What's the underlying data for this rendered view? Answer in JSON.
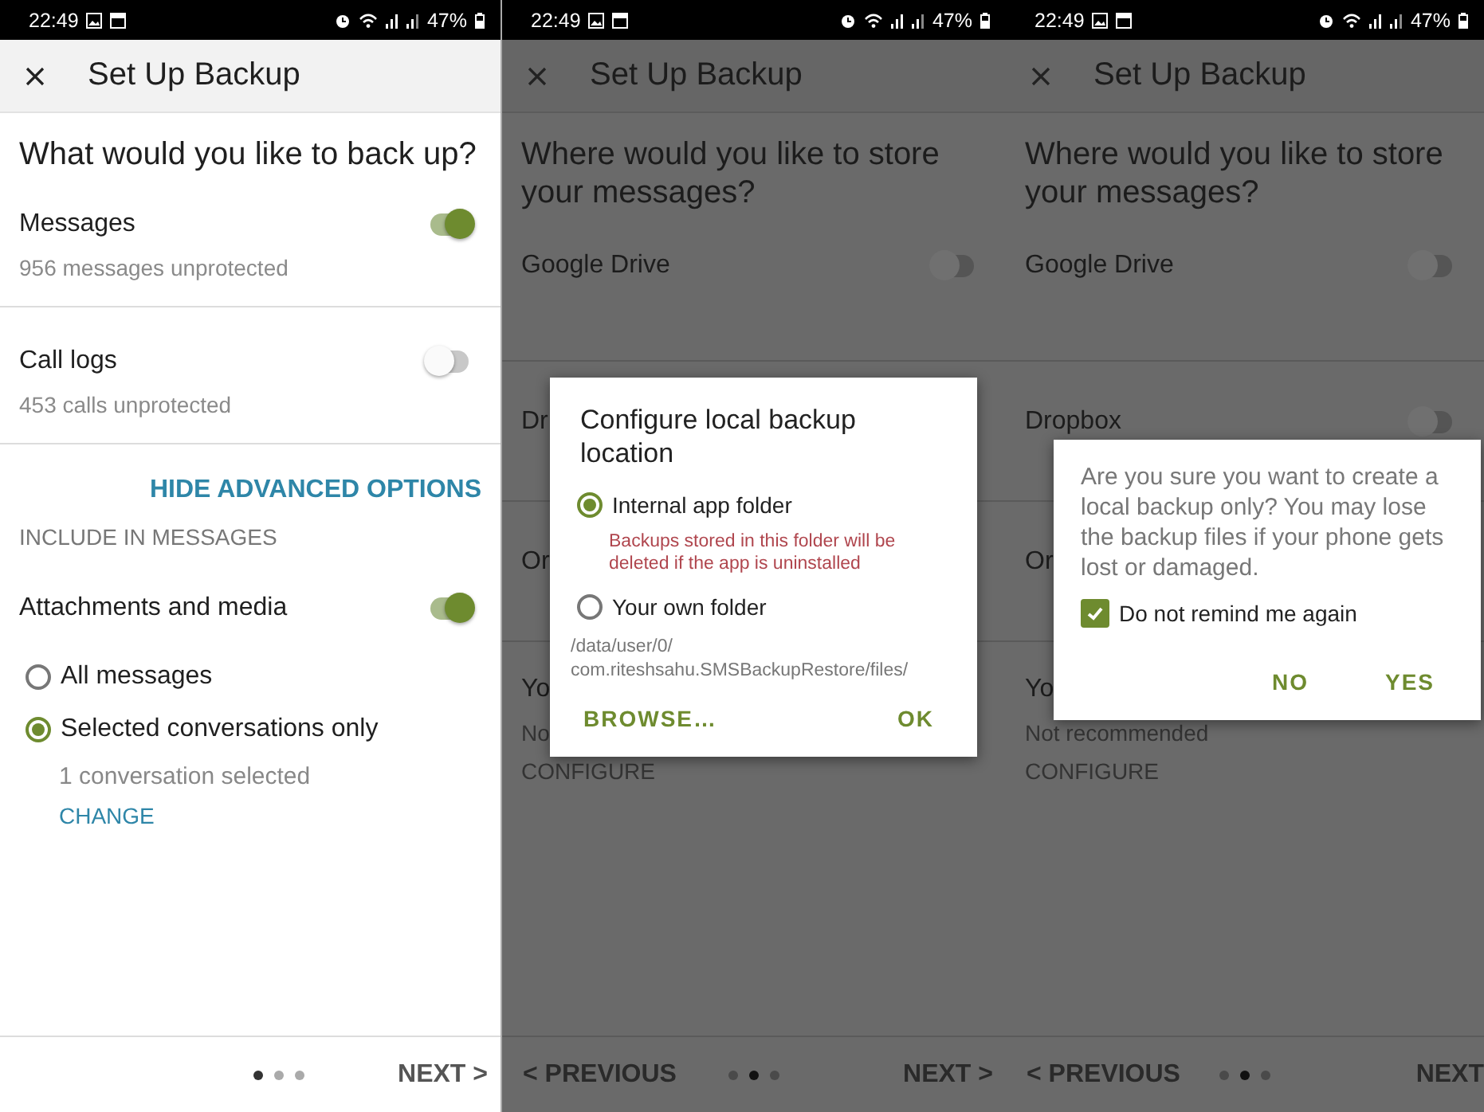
{
  "screens": [
    {
      "kind": "options",
      "status_bar": {
        "time": "22:49",
        "battery": "47%"
      },
      "title": "Set Up Backup",
      "heading": "What would you like to back up?",
      "options": [
        {
          "label": "Messages",
          "detail": "956 messages unprotected",
          "on": true
        },
        {
          "label": "Call logs",
          "detail": "453 calls unprotected",
          "on": false
        }
      ],
      "advanced_link": "HIDE ADVANCED OPTIONS",
      "section_label": "INCLUDE IN MESSAGES",
      "attachments": {
        "label": "Attachments and media",
        "on": true
      },
      "scope": [
        {
          "label": "All messages",
          "selected": false
        },
        {
          "label": "Selected conversations only",
          "selected": true,
          "detail": "1 conversation selected",
          "action": "CHANGE"
        }
      ],
      "footer": {
        "pager": [
          {
            "selected": true
          },
          {
            "selected": false
          },
          {
            "selected": false
          }
        ],
        "next": "NEXT >"
      }
    },
    {
      "kind": "destinations",
      "status_bar": {
        "time": "22:49",
        "battery": "47%"
      },
      "title": "Set Up Backup",
      "heading": "Where would you like to store your messages?",
      "destinations": [
        {
          "label": "Google Drive",
          "on": false
        },
        {
          "label": "Dr"
        },
        {
          "label": "Or"
        },
        {
          "label": "Yo",
          "detail": "No",
          "action": "CONFIGURE"
        }
      ],
      "dialog": {
        "kind": "location",
        "title": "Configure local backup location",
        "choices": [
          {
            "label": "Internal app folder",
            "selected": true,
            "warning": "Backups stored in this folder will be deleted if the app is uninstalled"
          },
          {
            "label": "Your own folder",
            "selected": false
          }
        ],
        "path": [
          "/data/user/0/",
          "com.riteshsahu.SMSBackupRestore/files/"
        ],
        "buttons": [
          "BROWSE…",
          "OK"
        ]
      },
      "footer": {
        "previous": "< PREVIOUS",
        "pager": [
          {
            "selected": false
          },
          {
            "selected": true
          },
          {
            "selected": false
          }
        ],
        "next": "NEXT >"
      }
    },
    {
      "kind": "destinations",
      "status_bar": {
        "time": "22:49",
        "battery": "47%"
      },
      "title": "Set Up Backup",
      "heading": "Where would you like to store your messages?",
      "destinations": [
        {
          "label": "Google Drive",
          "on": false
        },
        {
          "label": "Dropbox",
          "on": false
        },
        {
          "label": "Or"
        },
        {
          "label": "Yo",
          "detail": "Not recommended",
          "action": "CONFIGURE"
        }
      ],
      "dialog": {
        "kind": "confirm",
        "message": "Are you sure you want to create a local backup only? You may lose the backup files if your phone gets lost or damaged.",
        "checkbox": {
          "label": "Do not remind me again",
          "checked": true
        },
        "buttons": [
          "NO",
          "YES"
        ]
      },
      "footer": {
        "previous": "< PREVIOUS",
        "pager": [
          {
            "selected": false
          },
          {
            "selected": true
          },
          {
            "selected": false
          }
        ],
        "next": "NEXT"
      }
    }
  ]
}
